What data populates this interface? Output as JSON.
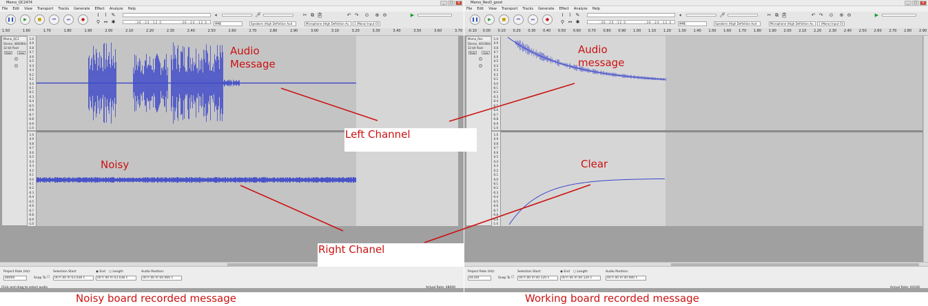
{
  "windows": [
    {
      "title": "Memo_QC2474",
      "menu": [
        "File",
        "Edit",
        "View",
        "Transport",
        "Tracks",
        "Generate",
        "Effect",
        "Analyze",
        "Help"
      ],
      "meter_ticks": "-36  -24  -12  0",
      "host": "MME",
      "output_device": "Speakers (High Definition Aud",
      "input_device": "Microphone (High Definition Au",
      "channels": "1 (Mono) Input Ch",
      "ruler_ticks": [
        "1.50",
        "1.60",
        "1.70",
        "1.80",
        "1.90",
        "2.00",
        "2.10",
        "2.20",
        "2.30",
        "2.40",
        "2.50",
        "2.60",
        "2.70",
        "2.80",
        "2.90",
        "3.00",
        "3.10",
        "3.20",
        "3.30",
        "3.40",
        "3.50",
        "3.60",
        "3.70"
      ],
      "track": {
        "name": "Memo_QC2",
        "info1": "Stereo, 48000Hz",
        "info2": "32-bit float",
        "mute": "Mute",
        "solo": "Solo"
      },
      "scale_labels": [
        "1.0",
        "0.9",
        "0.8",
        "0.7",
        "0.6",
        "0.5",
        "0.4",
        "0.3",
        "0.2",
        "0.1",
        "0.0",
        "-0.1",
        "-0.2",
        "-0.3",
        "-0.4",
        "-0.5",
        "-0.6",
        "-0.7",
        "-0.8",
        "-0.9",
        "-1.0"
      ],
      "project_rate_label": "Project Rate (Hz):",
      "project_rate": "48000",
      "snap_label": "Snap To",
      "selection_start_label": "Selection Start:",
      "end_label": "End",
      "length_label": "Length",
      "audio_position_label": "Audio Position:",
      "selection_start": "00 h 00 m 03.038 s",
      "selection_end": "00 h 00 m 03.038 s",
      "audio_position": "00 h 00 m 00.000 s",
      "status_left": "Click and drag to select audio",
      "status_right": "Actual Rate: 48000"
    },
    {
      "title": "Memo_RevD_good",
      "menu": [
        "File",
        "Edit",
        "View",
        "Transport",
        "Tracks",
        "Generate",
        "Effect",
        "Analyze",
        "Help"
      ],
      "meter_ticks": "-36  -24  -12  0",
      "host": "MME",
      "output_device": "Speakers (High Definition Aud",
      "input_device": "Microphone (High Definition Au",
      "channels": "1 (Mono) Input Ch",
      "ruler_ticks": [
        "-0.10",
        "0.00",
        "0.10",
        "0.20",
        "0.30",
        "0.40",
        "0.50",
        "0.60",
        "0.70",
        "0.80",
        "0.90",
        "1.00",
        "1.10",
        "1.20",
        "1.30",
        "1.40",
        "1.50",
        "1.60",
        "1.70",
        "1.80",
        "1.90",
        "2.00",
        "2.10",
        "2.20",
        "2.30",
        "2.40",
        "2.50",
        "2.60",
        "2.70",
        "2.80",
        "2.90"
      ],
      "track": {
        "name": "Memo_Rev",
        "info1": "Stereo, 44100Hz",
        "info2": "32-bit float",
        "mute": "Mute",
        "solo": "Solo"
      },
      "scale_labels": [
        "1.0",
        "0.9",
        "0.8",
        "0.7",
        "0.6",
        "0.5",
        "0.4",
        "0.3",
        "0.2",
        "0.1",
        "0.0",
        "-0.1",
        "-0.2",
        "-0.3",
        "-0.4",
        "-0.5",
        "-0.6",
        "-0.7",
        "-0.8",
        "-0.9",
        "-1.0"
      ],
      "project_rate_label": "Project Rate (Hz):",
      "project_rate": "44100",
      "snap_label": "Snap To",
      "selection_start_label": "Selection Start:",
      "end_label": "End",
      "length_label": "Length",
      "audio_position_label": "Audio Position:",
      "selection_start": "00 h 00 m 00.120 s",
      "selection_end": "00 h 00 m 00.120 s",
      "audio_position": "00 h 00 m 00.000 s",
      "status_left": "",
      "status_right": "Actual Rate: 44100"
    }
  ],
  "annotations": {
    "audio_message_left": "Audio\nMessage",
    "audio_message_right": "Audio\nmessage",
    "left_channel": "Left Channel",
    "noisy": "Noisy",
    "clear": "Clear",
    "right_channel": "Right Chanel",
    "caption_left": "Noisy board recorded message",
    "caption_right": "Working board recorded message",
    "color": "#cc1111"
  },
  "colors": {
    "waveform": "#3b47c9",
    "track_bg": "#c4c4c4",
    "selection_bg": "#d6d6d6"
  }
}
